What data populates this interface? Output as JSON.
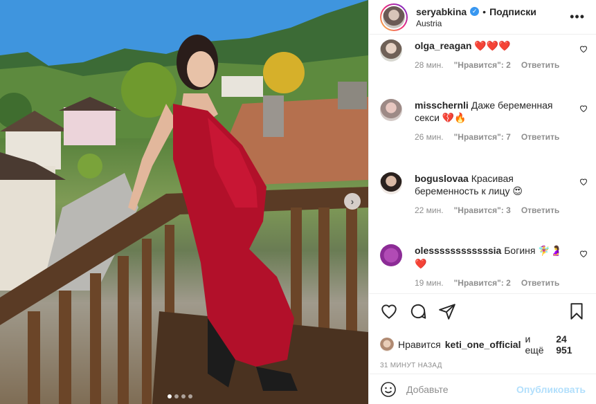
{
  "header": {
    "username": "seryabkina",
    "separator": "•",
    "follow": "Подписки",
    "location": "Austria",
    "more": "•••"
  },
  "photo": {
    "next_arrow": "›",
    "carousel": {
      "count": 4,
      "active_index": 0
    }
  },
  "comments": [
    {
      "username": "olga_reagan",
      "text": "",
      "emoji": "❤️❤️❤️",
      "time": "28 мин.",
      "likes": "\"Нравится\": 2",
      "reply": "Ответить"
    },
    {
      "username": "misschernli",
      "text": "Даже беременная секси",
      "emoji": "💔🔥",
      "time": "26 мин.",
      "likes": "\"Нравится\": 7",
      "reply": "Ответить"
    },
    {
      "username": "boguslovaa",
      "text": "Красивая беременность к лицу",
      "emoji": "😍",
      "time": "22 мин.",
      "likes": "\"Нравится\": 3",
      "reply": "Ответить"
    },
    {
      "username": "olessssssssssssia",
      "text": "Богиня",
      "emoji": "🧚‍♀️🤰❤️",
      "time": "19 мин.",
      "likes": "\"Нравится\": 2",
      "reply": "Ответить"
    }
  ],
  "likes_line": {
    "prefix": "Нравится",
    "user": "keti_one_official",
    "middle": "и ещё",
    "count": "24 951"
  },
  "post_time": "31 МИНУТ НАЗАД",
  "add_comment": {
    "placeholder": "Добавьте",
    "publish": "Опубликовать"
  },
  "icons": {
    "like": "heart-icon",
    "comment": "comment-icon",
    "share": "paper-plane-icon",
    "save": "bookmark-icon",
    "emoji": "smiley-icon"
  }
}
